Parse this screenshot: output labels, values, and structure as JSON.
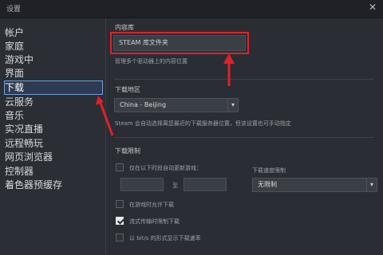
{
  "window": {
    "title": "设置",
    "close_glyph": "✕"
  },
  "sidebar": {
    "items": [
      {
        "label": "帐户"
      },
      {
        "label": "家庭"
      },
      {
        "label": "游戏中"
      },
      {
        "label": "界面"
      },
      {
        "label": "下载",
        "selected": true
      },
      {
        "label": "云服务"
      },
      {
        "label": "音乐"
      },
      {
        "label": "实况直播"
      },
      {
        "label": "远程畅玩"
      },
      {
        "label": "网页浏览器"
      },
      {
        "label": "控制器"
      },
      {
        "label": "着色器预缓存"
      }
    ]
  },
  "library": {
    "heading": "内容库",
    "button_label": "STEAM 库文件夹",
    "description": "管理多个驱动器上的内容位置"
  },
  "region": {
    "heading": "下载地区",
    "selected": "China - Beijing",
    "description": "Steam 会自动选择离您最近的下载服务器位置，但该设置也可手动指定"
  },
  "restrictions": {
    "heading": "下载限制",
    "only_between_label": "仅在以下时段自动更新游戏：",
    "to_label": "至",
    "bandwidth_label": "下载速度限制",
    "bandwidth_value": "无限制",
    "allow_in_game_label": "在游戏时允许下载",
    "throttle_streaming_label": "流式传输时限制下载",
    "show_bits_label": "以 bit/s 的形式显示下载速率"
  },
  "checkboxes": {
    "only_between": false,
    "allow_in_game": false,
    "throttle_streaming": true,
    "show_bits": false
  },
  "colors": {
    "highlight_red": "#e0202a",
    "selected_outline": "#6ea0d8"
  },
  "icons": {
    "close": "close-icon",
    "dropdown": "chevron-down-icon",
    "annotation": "red-arrow-icon"
  }
}
